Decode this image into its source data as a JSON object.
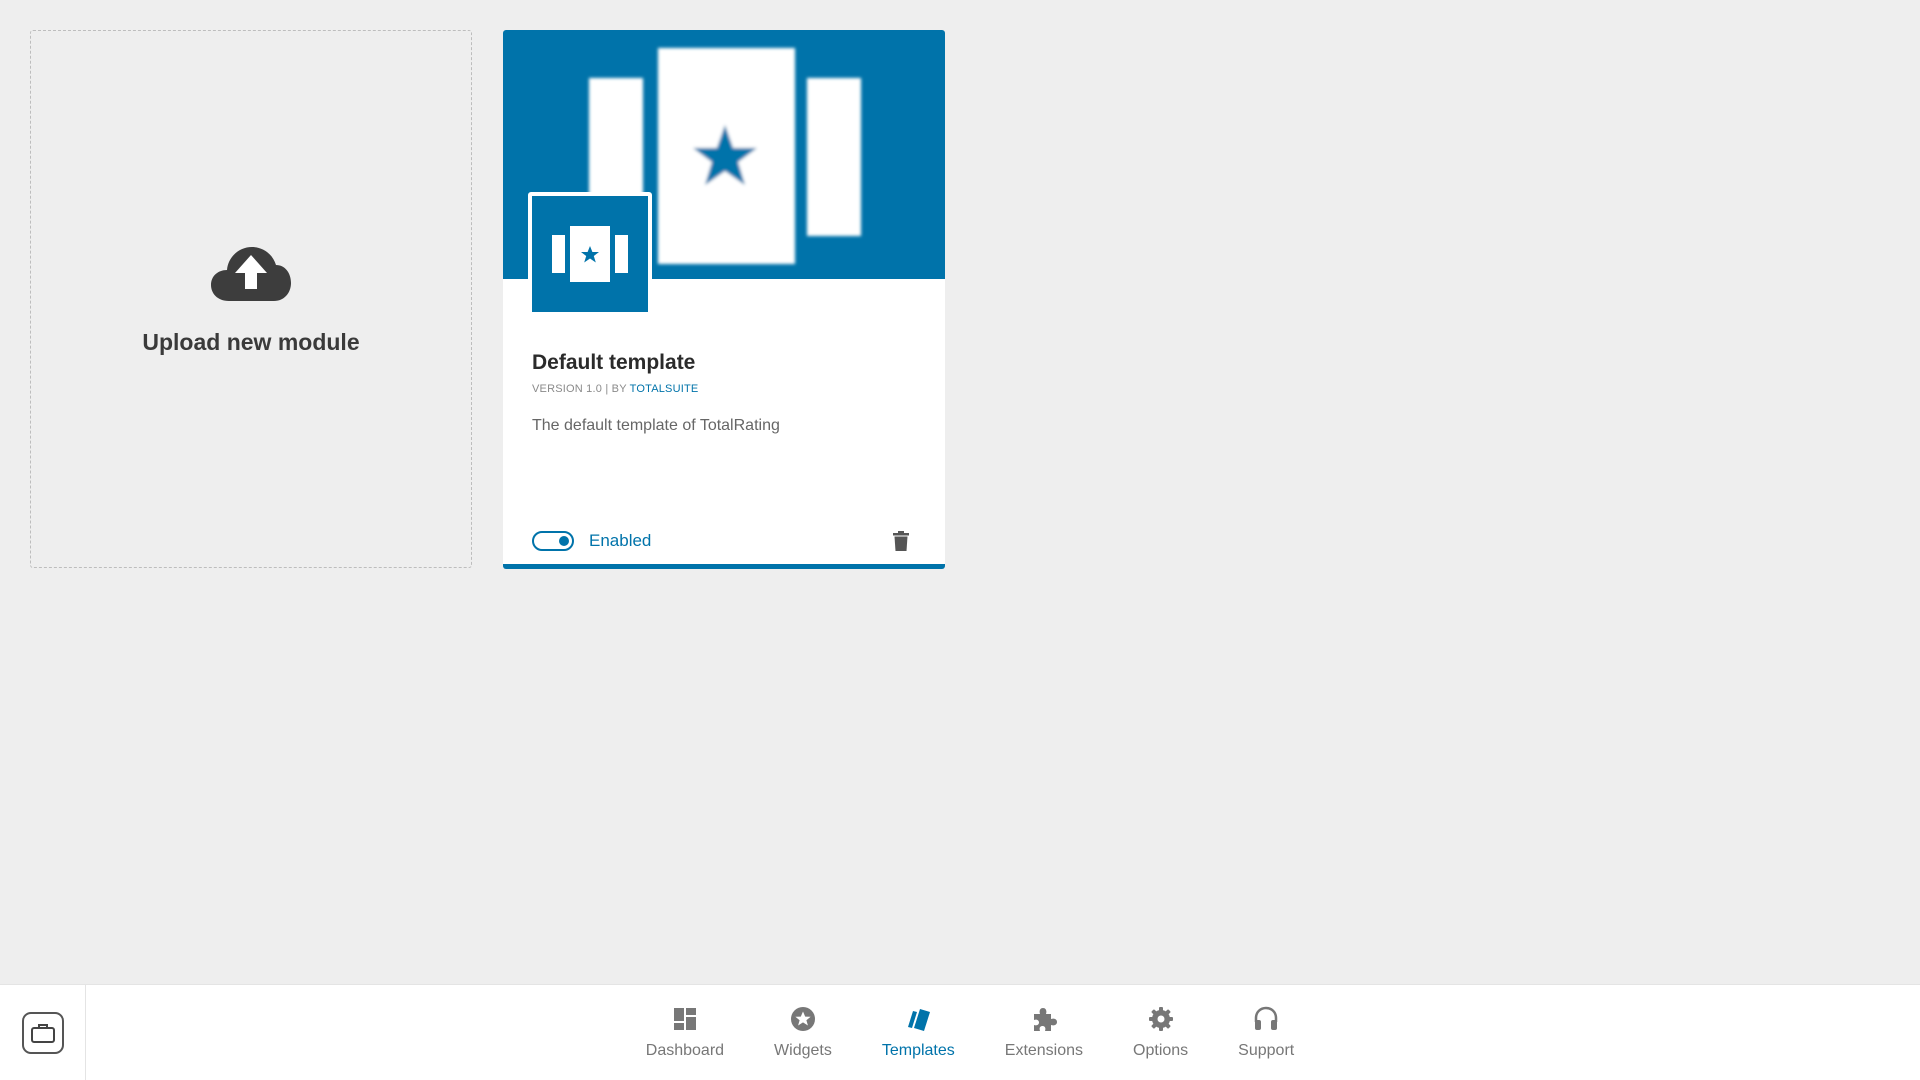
{
  "upload": {
    "label": "Upload new module",
    "icon": "cloud-upload-icon"
  },
  "template_card": {
    "title": "Default template",
    "version": "VERSION 1.0",
    "separator": "|",
    "by": "BY",
    "author": "TOTALSUITE",
    "description": "The default template of TotalRating",
    "status_label": "Enabled",
    "enabled": true,
    "accent_color": "#0073aa",
    "delete_icon": "trash-icon"
  },
  "bottom_nav": {
    "suite_icon": "briefcase-icon",
    "items": [
      {
        "label": "Dashboard",
        "icon": "dashboard-icon",
        "active": false
      },
      {
        "label": "Widgets",
        "icon": "star-circle-icon",
        "active": false
      },
      {
        "label": "Templates",
        "icon": "templates-icon",
        "active": true
      },
      {
        "label": "Extensions",
        "icon": "puzzle-icon",
        "active": false
      },
      {
        "label": "Options",
        "icon": "gear-icon",
        "active": false
      },
      {
        "label": "Support",
        "icon": "headphones-icon",
        "active": false
      }
    ]
  }
}
